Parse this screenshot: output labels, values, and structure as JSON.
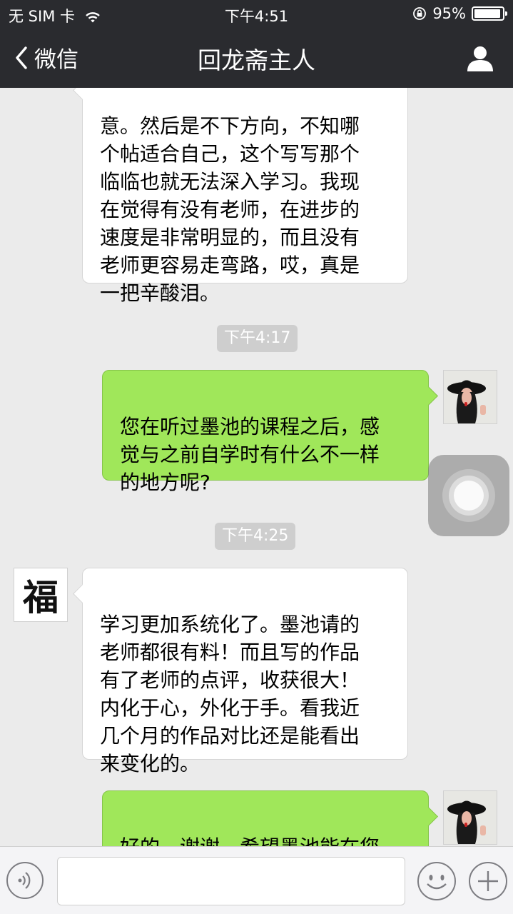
{
  "status_bar": {
    "carrier": "无 SIM 卡",
    "time": "下午4:51",
    "battery": "95%",
    "battery_level": 0.95
  },
  "nav": {
    "back_label": "微信",
    "title": "回龙斋主人"
  },
  "messages": {
    "m1": {
      "direction": "incoming",
      "text": "意。然后是不下方向，不知哪\n个帖适合自己，这个写写那个\n临临也就无法深入学习。我现\n在觉得有没有老师，在进步的\n速度是非常明显的，而且没有\n老师更容易走弯路，哎，真是\n一把辛酸泪。"
    },
    "t1": {
      "text": "下午4:17"
    },
    "m2": {
      "direction": "outgoing",
      "text": "您在听过墨池的课程之后，感\n觉与之前自学时有什么不一样\n的地方呢?"
    },
    "t2": {
      "text": "下午4:25"
    },
    "m3": {
      "direction": "incoming",
      "text": "学习更加系统化了。墨池请的\n老师都很有料！而且写的作品\n有了老师的点评，收获很大！\n内化于心，外化于手。看我近\n几个月的作品对比还是能看出\n来变化的。"
    },
    "m4": {
      "direction": "outgoing",
      "text": "好的，谢谢。希望墨池能在您\n学习书法的道路上更多地帮到"
    }
  },
  "avatars": {
    "contact_char": "福"
  },
  "icons": [
    "wifi-icon",
    "lock-rotation-icon",
    "battery-icon",
    "back-chevron-icon",
    "person-icon",
    "voice-icon",
    "emoji-icon",
    "plus-icon"
  ],
  "colors": {
    "bar_bg": "#2a2b2f",
    "chat_bg": "#ebebeb",
    "outgoing_bubble": "#a0e75a",
    "incoming_bubble": "#ffffff",
    "timestamp_bg": "#cecece"
  }
}
